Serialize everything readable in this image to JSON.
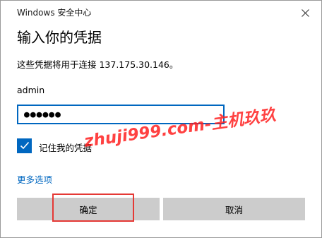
{
  "window": {
    "title": "Windows 安全中心"
  },
  "dialog": {
    "heading": "输入你的凭据",
    "message": "这些凭据将用于连接 137.175.30.146。",
    "username": "admin",
    "password_masked": "●●●●●●",
    "remember_label": "记住我的凭据",
    "remember_checked": true,
    "more_options_label": "更多选项",
    "ok_label": "确定",
    "cancel_label": "取消"
  },
  "watermark": {
    "text": "zhuji999.com-主机玖玖"
  },
  "colors": {
    "accent": "#0067c0",
    "button_bg": "#cccccc",
    "highlight": "#e53935",
    "watermark": "#ff2020"
  }
}
